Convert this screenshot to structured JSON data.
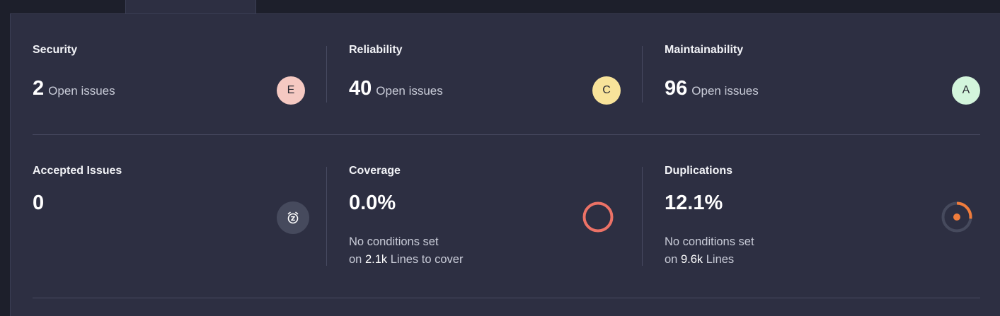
{
  "colors": {
    "grade_e": "#f5c9c2",
    "grade_c": "#f8e39a",
    "grade_a": "#d3f5dc",
    "coverage_ring": "#ec7266",
    "duplication_accent": "#ef7c3c"
  },
  "issues": {
    "security": {
      "title": "Security",
      "count": "2",
      "label": "Open issues",
      "grade": "E"
    },
    "reliability": {
      "title": "Reliability",
      "count": "40",
      "label": "Open issues",
      "grade": "C"
    },
    "maintainability": {
      "title": "Maintainability",
      "count": "96",
      "label": "Open issues",
      "grade": "A"
    }
  },
  "accepted": {
    "title": "Accepted Issues",
    "value": "0",
    "icon": "alarm-snooze-icon"
  },
  "coverage": {
    "title": "Coverage",
    "value": "0.0%",
    "percent": 0.0,
    "line1": "No conditions set",
    "prefix": "on",
    "amount": "2.1k",
    "suffix": "Lines to cover"
  },
  "duplications": {
    "title": "Duplications",
    "value": "12.1%",
    "percent": 12.1,
    "line1": "No conditions set",
    "prefix": "on",
    "amount": "9.6k",
    "suffix": "Lines"
  }
}
